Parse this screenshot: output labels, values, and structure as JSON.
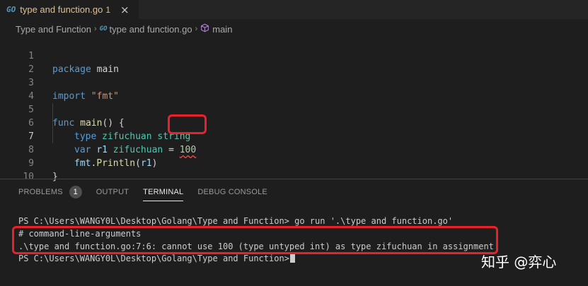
{
  "tab": {
    "icon": "go-file-icon",
    "icon_text": "GO",
    "title": "type and function.go",
    "problem_count": "1",
    "close_glyph": "×"
  },
  "breadcrumb": {
    "folder": "Type and Function",
    "file": "type and function.go",
    "symbol": "main",
    "separator": "›"
  },
  "editor": {
    "active_line": 7,
    "line_numbers": [
      "1",
      "2",
      "3",
      "4",
      "5",
      "6",
      "7",
      "8",
      "9",
      "10"
    ],
    "lines": {
      "l1": {
        "kw": "package",
        "rest": " main"
      },
      "l3": {
        "kw": "import",
        "sp": " ",
        "str": "\"fmt\""
      },
      "l5": {
        "kw": "func",
        "sp": " ",
        "fn": "main",
        "rest": "() {"
      },
      "l6": {
        "kw": "type",
        "sp": " ",
        "type": "zifuchuan",
        "sp2": " ",
        "type2": "string"
      },
      "l7": {
        "kw": "var",
        "sp": " ",
        "var": "r1",
        "sp2": " ",
        "type": "zifuchuan",
        "op": " = ",
        "num": "100"
      },
      "l8": {
        "var": "fmt",
        "dot": ".",
        "fn": "Println",
        "open": "(",
        "arg": "r1",
        "close": ")"
      },
      "l9": {
        "rest": "}"
      }
    }
  },
  "panel": {
    "tabs": [
      "PROBLEMS",
      "OUTPUT",
      "TERMINAL",
      "DEBUG CONSOLE"
    ],
    "active_tab": "TERMINAL",
    "problems_badge": "1"
  },
  "terminal": {
    "lines": [
      "PS C:\\Users\\WANGY0L\\Desktop\\Golang\\Type and Function> go run '.\\type and function.go'",
      "# command-line-arguments",
      ".\\type and function.go:7:6: cannot use 100 (type untyped int) as type zifuchuan in assignment",
      "PS C:\\Users\\WANGY0L\\Desktop\\Golang\\Type and Function>"
    ]
  },
  "watermark": "知乎 @弈心",
  "colors": {
    "background": "#1e1e1e",
    "highlight_box": "#e8212b",
    "modified_tab_text": "#e2c08d"
  }
}
